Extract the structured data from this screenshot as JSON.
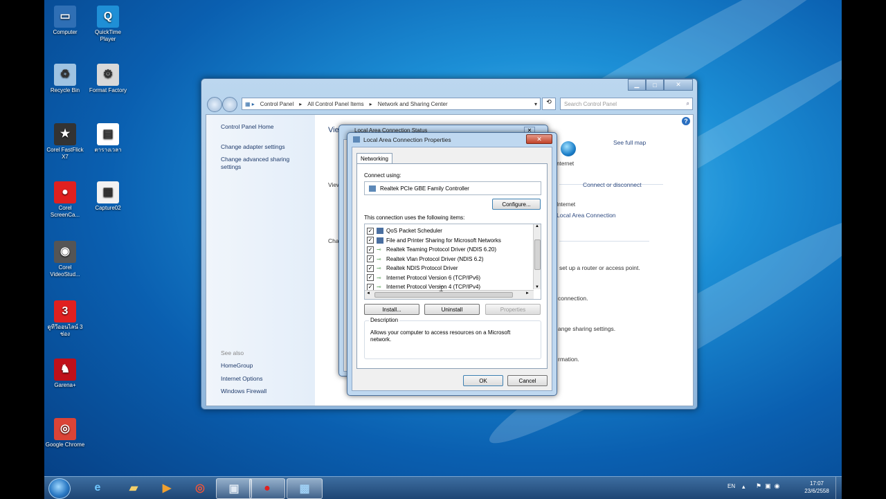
{
  "desktop_icons": [
    {
      "label": "Computer",
      "icon": "computer-icon",
      "color": "#2f6fb5"
    },
    {
      "label": "QuickTime Player",
      "icon": "quicktime-icon",
      "color": "#1f8fd6"
    },
    {
      "label": "Recycle Bin",
      "icon": "recycle-bin-icon",
      "color": "#9fc3e2"
    },
    {
      "label": "Format Factory",
      "icon": "format-factory-icon",
      "color": "#d9d9d9"
    },
    {
      "label": "Corel FastFlick X7",
      "icon": "fastflick-icon",
      "color": "#333333"
    },
    {
      "label": "ตารางเวลา",
      "icon": "document-icon",
      "color": "#ffffff"
    },
    {
      "label": "Corel ScreenCa...",
      "icon": "screencap-icon",
      "color": "#e02020"
    },
    {
      "label": "Capture02",
      "icon": "file-icon",
      "color": "#f2f2f2"
    },
    {
      "label": "Corel VideoStud...",
      "icon": "videostudio-icon",
      "color": "#555555"
    },
    {
      "label": "ดูทีวีออนไลน์ 3 ช่อง",
      "icon": "channel3-icon",
      "color": "#e02020"
    },
    {
      "label": "Garena+",
      "icon": "garena-icon",
      "color": "#c0101a"
    },
    {
      "label": "Google Chrome",
      "icon": "chrome-icon",
      "color": "#db4437"
    }
  ],
  "explorer": {
    "breadcrumb": [
      "Control Panel",
      "All Control Panel Items",
      "Network and Sharing Center"
    ],
    "search_placeholder": "Search Control Panel",
    "left_links": [
      "Control Panel Home",
      "Change adapter settings",
      "Change advanced sharing settings"
    ],
    "see_also_title": "See also",
    "see_also": [
      "HomeGroup",
      "Internet Options",
      "Windows Firewall"
    ],
    "main_fragments": {
      "view_title": "Vie",
      "view2": "View",
      "change": "Cha",
      "see_full_map": "See full map",
      "internet_label": "Internet",
      "connect_disconnect": "Connect or disconnect",
      "internet2": "Internet",
      "local_area_conn": "Local Area Connection",
      "setup_router": "set up a router or access point.",
      "connection": "connection.",
      "change_sharing": "ange sharing settings.",
      "rmation": "rmation."
    }
  },
  "status_dialog": {
    "title": "Local Area Connection Status"
  },
  "props_dialog": {
    "title": "Local Area Connection Properties",
    "tab": "Networking",
    "connect_using_label": "Connect using:",
    "adapter": "Realtek PCIe GBE Family Controller",
    "configure": "Configure...",
    "items_label": "This connection uses the following items:",
    "items": [
      {
        "label": "QoS Packet Scheduler",
        "checked": true,
        "icon": "network-service-icon"
      },
      {
        "label": "File and Printer Sharing for Microsoft Networks",
        "checked": true,
        "icon": "network-service-icon"
      },
      {
        "label": "Realtek Teaming Protocol Driver (NDIS 6.20)",
        "checked": true,
        "icon": "protocol-icon"
      },
      {
        "label": "Realtek Vlan Protocol Driver (NDIS 6.2)",
        "checked": true,
        "icon": "protocol-icon"
      },
      {
        "label": "Realtek NDIS Protocol Driver",
        "checked": true,
        "icon": "protocol-icon"
      },
      {
        "label": "Internet Protocol Version 6 (TCP/IPv6)",
        "checked": true,
        "icon": "protocol-icon"
      },
      {
        "label": "Internet Protocol Version 4 (TCP/IPv4)",
        "checked": true,
        "icon": "protocol-icon"
      }
    ],
    "install": "Install...",
    "uninstall": "Uninstall",
    "properties": "Properties",
    "description_label": "Description",
    "description": "Allows your computer to access resources on a Microsoft network.",
    "ok": "OK",
    "cancel": "Cancel"
  },
  "taskbar": {
    "buttons": [
      {
        "name": "ie",
        "icon": "internet-explorer-icon"
      },
      {
        "name": "explorer",
        "icon": "folder-icon"
      },
      {
        "name": "media",
        "icon": "media-player-icon"
      },
      {
        "name": "chrome",
        "icon": "chrome-icon"
      },
      {
        "name": "control-panel",
        "icon": "window-icon"
      },
      {
        "name": "recorder",
        "icon": "record-icon"
      },
      {
        "name": "network",
        "icon": "network-icon"
      }
    ],
    "lang": "EN",
    "time": "17:07",
    "date": "23/6/2558"
  }
}
